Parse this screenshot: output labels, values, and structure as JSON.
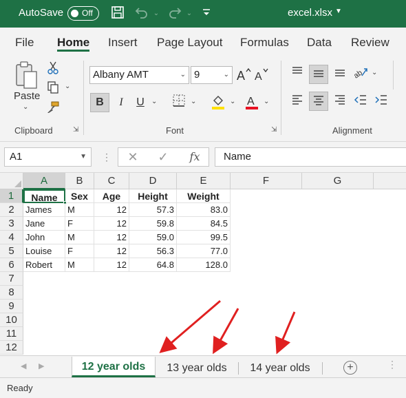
{
  "titlebar": {
    "autosave_label": "AutoSave",
    "autosave_state": "Off",
    "filename": "excel.xlsx"
  },
  "tabs": [
    "File",
    "Home",
    "Insert",
    "Page Layout",
    "Formulas",
    "Data",
    "Review"
  ],
  "ribbon": {
    "clipboard": {
      "paste_label": "Paste",
      "group_label": "Clipboard"
    },
    "font": {
      "name": "Albany AMT",
      "size": "9",
      "group_label": "Font",
      "bold": "B",
      "italic": "I",
      "underline": "U",
      "grow": "A^",
      "shrink": "A˅",
      "font_color_letter": "A"
    },
    "alignment": {
      "group_label": "Alignment"
    }
  },
  "formula_bar": {
    "name_box": "A1",
    "fx": "fx",
    "content": "Name"
  },
  "grid": {
    "columns": [
      "A",
      "B",
      "C",
      "D",
      "E",
      "F",
      "G"
    ],
    "rows": [
      "1",
      "2",
      "3",
      "4",
      "5",
      "6",
      "7",
      "8",
      "9",
      "10",
      "11",
      "12"
    ],
    "header": [
      "Name",
      "Sex",
      "Age",
      "Height",
      "Weight"
    ],
    "data": [
      [
        "James",
        "M",
        "12",
        "57.3",
        "83.0"
      ],
      [
        "Jane",
        "F",
        "12",
        "59.8",
        "84.5"
      ],
      [
        "John",
        "M",
        "12",
        "59.0",
        "99.5"
      ],
      [
        "Louise",
        "F",
        "12",
        "56.3",
        "77.0"
      ],
      [
        "Robert",
        "M",
        "12",
        "64.8",
        "128.0"
      ]
    ]
  },
  "sheets": [
    "12 year olds",
    "13 year olds",
    "14 year olds"
  ],
  "status": "Ready",
  "colors": {
    "accent": "#1e7145",
    "annotation": "#e02020"
  }
}
